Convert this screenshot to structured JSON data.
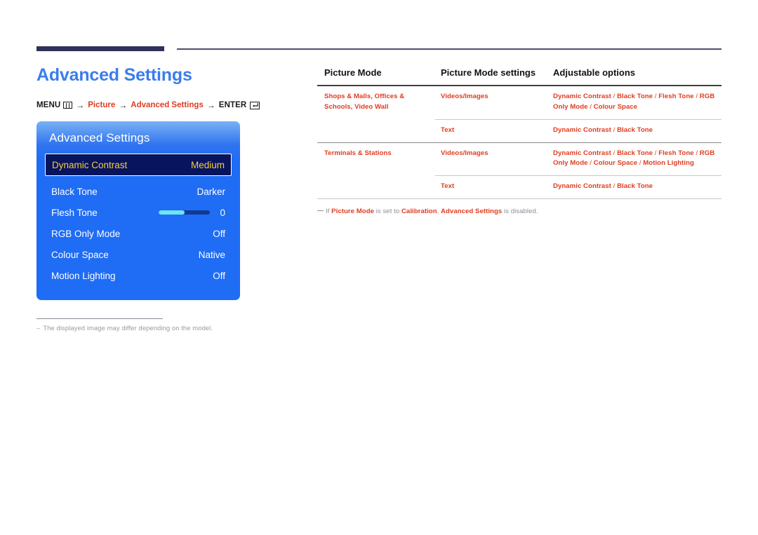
{
  "page": {
    "title": "Advanced Settings"
  },
  "breadcrumb": {
    "menu_label": "MENU",
    "menu_icon": "menu-grid-icon",
    "arrow": "→",
    "step1": "Picture",
    "step2": "Advanced Settings",
    "enter_label": "ENTER",
    "enter_icon": "enter-key-icon"
  },
  "osd": {
    "title": "Advanced Settings",
    "rows": [
      {
        "label": "Dynamic Contrast",
        "value": "Medium",
        "selected": true,
        "type": "value"
      },
      {
        "label": "Black Tone",
        "value": "Darker",
        "selected": false,
        "type": "value"
      },
      {
        "label": "Flesh Tone",
        "value": "0",
        "selected": false,
        "type": "slider",
        "slider_percent": 50
      },
      {
        "label": "RGB Only Mode",
        "value": "Off",
        "selected": false,
        "type": "value"
      },
      {
        "label": "Colour Space",
        "value": "Native",
        "selected": false,
        "type": "value"
      },
      {
        "label": "Motion Lighting",
        "value": "Off",
        "selected": false,
        "type": "value"
      }
    ]
  },
  "left_note": {
    "dash": "–",
    "text": "The displayed image may differ depending on the model."
  },
  "table": {
    "headers": {
      "col1": "Picture Mode",
      "col2": "Picture Mode settings",
      "col3": "Adjustable options"
    },
    "rows": [
      {
        "mode": "Shops & Malls, Offices & Schools, Video Wall",
        "setting": "Videos/Images",
        "options": "Dynamic Contrast / Black Tone / Flesh Tone / RGB Only Mode / Colour Space"
      },
      {
        "mode": "",
        "setting": "Text",
        "options": "Dynamic Contrast / Black Tone"
      },
      {
        "mode": "Terminals & Stations",
        "setting": "Videos/Images",
        "options": "Dynamic Contrast / Black Tone / Flesh Tone / RGB Only Mode / Colour Space / Motion Lighting"
      },
      {
        "mode": "",
        "setting": "Text",
        "options": "Dynamic Contrast / Black Tone"
      }
    ]
  },
  "right_note": {
    "prefix": "If ",
    "bold1": "Picture Mode",
    "mid1": " is set to ",
    "bold2": "Calibration",
    "mid2": ", ",
    "bold3": "Advanced Settings",
    "suffix": " is disabled."
  },
  "colors": {
    "title_blue": "#3b7ded",
    "accent_red": "#e03c1f",
    "navy_rule": "#2e3257",
    "osd_blue": "#1f6cf5",
    "osd_selected_bg": "#08145e",
    "osd_selected_text": "#f5cf3e",
    "slider_fill": "#6fe4ef",
    "note_gray": "#9a9aa6"
  }
}
